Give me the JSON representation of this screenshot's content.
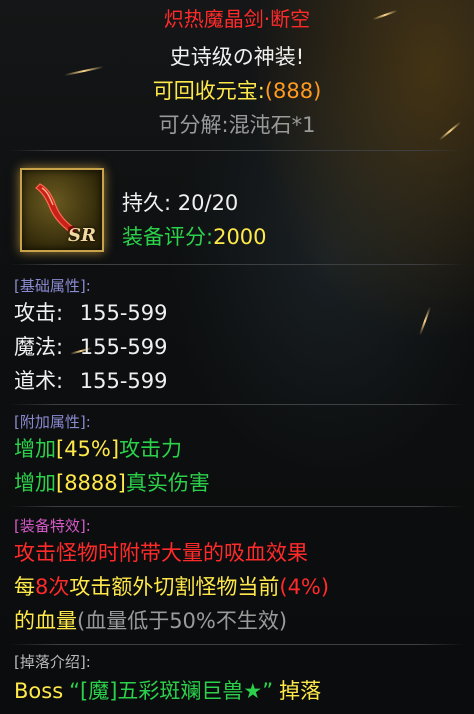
{
  "item": {
    "name": "炽热魔晶剑·断空",
    "quality": "史诗级の神装!",
    "recycle_label": "可回收元宝:",
    "recycle_value": "(888)",
    "decompose": "可分解:混沌石*1",
    "icon_badge": "SR",
    "durability_label": "持久:",
    "durability_value": "20/20",
    "score_label": "装备评分:",
    "score_value": "2000"
  },
  "base_attrs": {
    "header": "[基础属性]:",
    "rows": [
      {
        "label": "攻击:",
        "value": "155-599"
      },
      {
        "label": "魔法:",
        "value": "155-599"
      },
      {
        "label": "道术:",
        "value": "155-599"
      }
    ]
  },
  "extra_attrs": {
    "header": "[附加属性]:",
    "rows": [
      {
        "prefix": "增加",
        "value": "[45%]",
        "suffix": "攻击力"
      },
      {
        "prefix": "增加",
        "value": "[8888]",
        "suffix": "真实伤害"
      }
    ]
  },
  "special": {
    "header": "[装备特效]:",
    "line1": "攻击怪物时附带大量的吸血效果",
    "line2_a": "每",
    "line2_b": "8次",
    "line2_c": "攻击额外切割怪物当前",
    "line2_d": "(4%)",
    "line3_a": "的血量",
    "line3_b": "(血量低于50%不生效)"
  },
  "drop": {
    "header": "[掉落介绍]:",
    "boss": "Boss",
    "monster": "“[魔]五彩斑斓巨兽★”",
    "suffix": "掉落"
  },
  "colors": {
    "name": "#ff2a2a",
    "quality": "#f0f0f0",
    "recycle": "#ffe84a",
    "recycle_value": "#ff9a1f",
    "score": "#2bd14a",
    "header": "#8a8ad0",
    "special": "#ff2a2a"
  }
}
